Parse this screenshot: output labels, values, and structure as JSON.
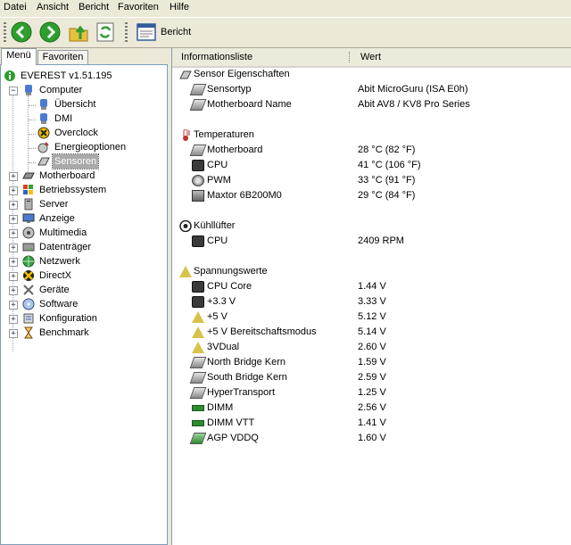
{
  "menu": [
    "Datei",
    "Ansicht",
    "Bericht",
    "Favoriten",
    "Hilfe"
  ],
  "toolbar": {
    "report_label": "Bericht"
  },
  "tabs": [
    "Menü",
    "Favoriten"
  ],
  "tree": {
    "root": "EVEREST v1.51.195",
    "computer": "Computer",
    "computer_children": [
      "Übersicht",
      "DMI",
      "Overclock",
      "Energieoptionen",
      "Sensoren"
    ],
    "items": [
      "Motherboard",
      "Betriebssystem",
      "Server",
      "Anzeige",
      "Multimedia",
      "Datenträger",
      "Netzwerk",
      "DirectX",
      "Geräte",
      "Software",
      "Konfiguration",
      "Benchmark"
    ]
  },
  "columns": {
    "info": "Informationsliste",
    "value": "Wert"
  },
  "sections": {
    "sensor": "Sensor Eigenschaften",
    "temp": "Temperaturen",
    "fan": "Kühllüfter",
    "volt": "Spannungswerte"
  },
  "sensor_rows": [
    {
      "k": "Sensortyp",
      "v": "Abit MicroGuru  (ISA E0h)"
    },
    {
      "k": "Motherboard Name",
      "v": "Abit AV8 / KV8 Pro Series"
    }
  ],
  "temp_rows": [
    {
      "k": "Motherboard",
      "v": "28 °C  (82 °F)"
    },
    {
      "k": "CPU",
      "v": "41 °C  (106 °F)"
    },
    {
      "k": "PWM",
      "v": "33 °C  (91 °F)"
    },
    {
      "k": "Maxtor 6B200M0",
      "v": "29 °C  (84 °F)"
    }
  ],
  "fan_rows": [
    {
      "k": "CPU",
      "v": "2409 RPM"
    }
  ],
  "volt_rows": [
    {
      "k": "CPU Core",
      "v": "1.44 V"
    },
    {
      "k": "+3.3 V",
      "v": "3.33 V"
    },
    {
      "k": "+5 V",
      "v": "5.12 V"
    },
    {
      "k": "+5 V Bereitschaftsmodus",
      "v": "5.14 V"
    },
    {
      "k": "3VDual",
      "v": "2.60 V"
    },
    {
      "k": "North Bridge Kern",
      "v": "1.59 V"
    },
    {
      "k": "South Bridge Kern",
      "v": "2.59 V"
    },
    {
      "k": "HyperTransport",
      "v": "1.25 V"
    },
    {
      "k": "DIMM",
      "v": "2.56 V"
    },
    {
      "k": "DIMM VTT",
      "v": "1.41 V"
    },
    {
      "k": "AGP VDDQ",
      "v": "1.60 V"
    }
  ]
}
